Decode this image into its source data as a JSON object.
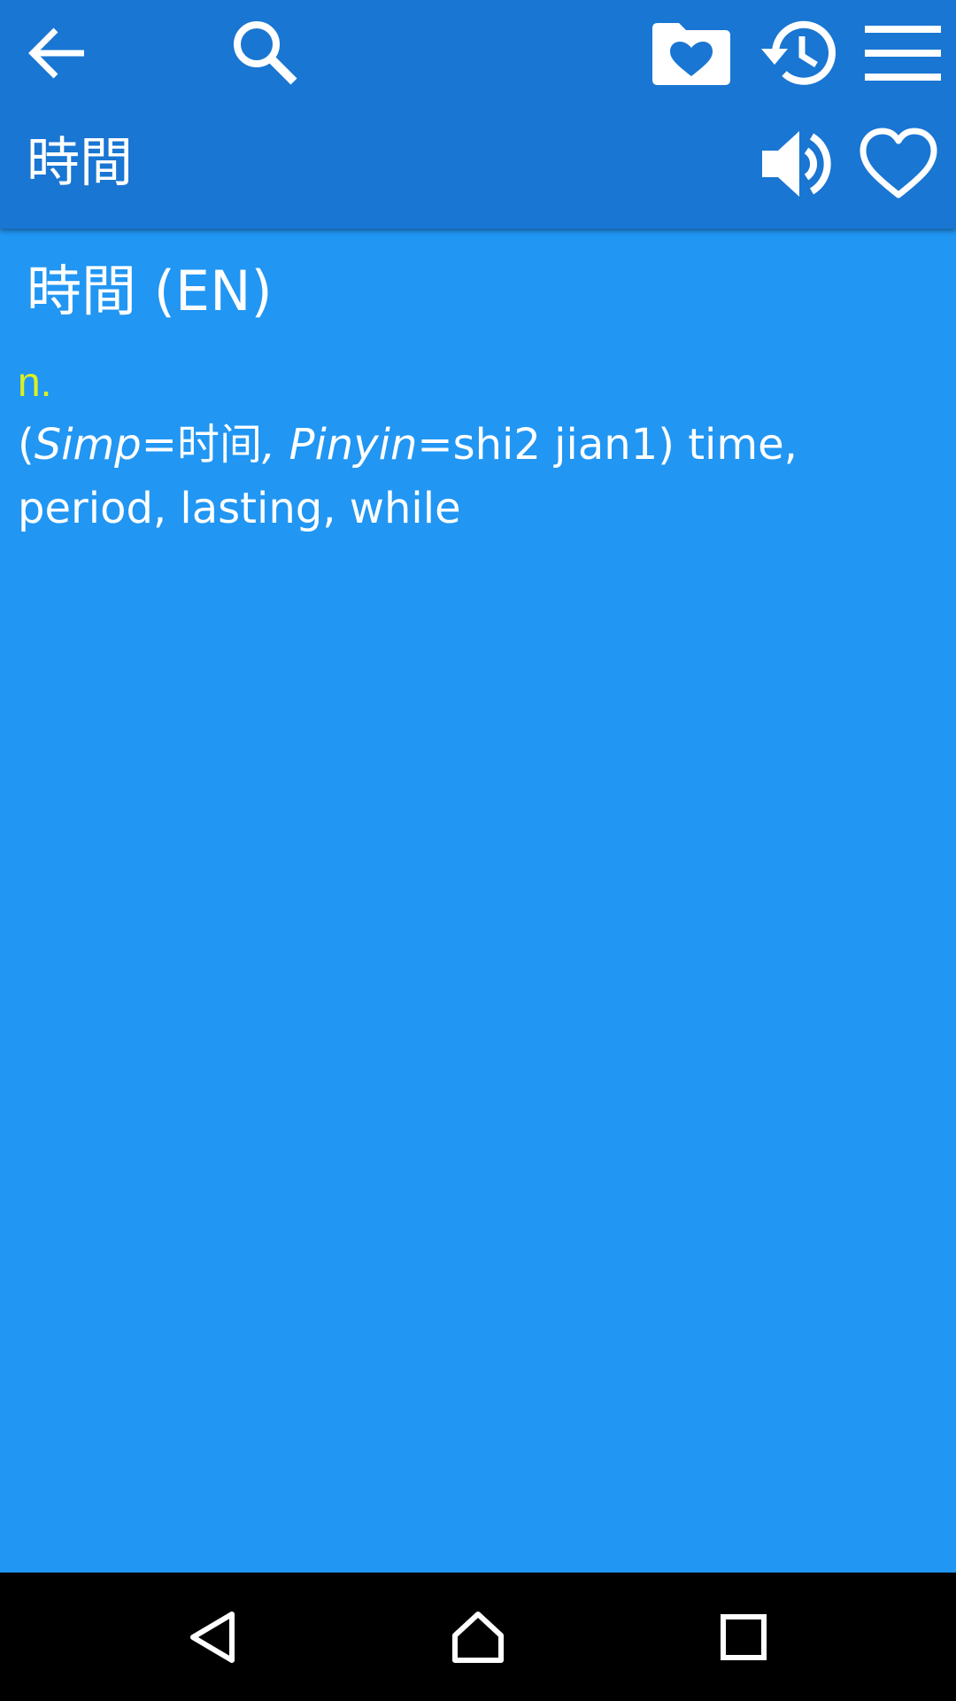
{
  "toolbar": {
    "icons": {
      "back": "arrow-left",
      "search": "magnifier",
      "favorites_folder": "folder-heart",
      "history": "history-clock",
      "menu": "hamburger"
    }
  },
  "word": {
    "title": "時間",
    "speak_icon": "speaker",
    "favorite_icon": "heart-outline"
  },
  "entry": {
    "heading": "時間 (EN)",
    "part_of_speech": "n.",
    "definition": {
      "open_paren": "(",
      "simp_label": "Simp",
      "simp_equals": "=",
      "simp_value": "时间",
      "separator": ", ",
      "pinyin_label": "Pinyin",
      "pinyin_equals": "=",
      "pinyin_value": "shi2 jian1",
      "close_paren": ")",
      "meaning": " time, period, lasting, while"
    }
  },
  "colors": {
    "app_bar": "#1976D2",
    "content_bg": "#2196F3",
    "part_of_speech": "#DDF01F",
    "text": "#FFFFFF",
    "nav_bar": "#000000"
  },
  "navbar": {
    "back_icon": "triangle-back",
    "home_icon": "home",
    "recents_icon": "square-recents"
  }
}
